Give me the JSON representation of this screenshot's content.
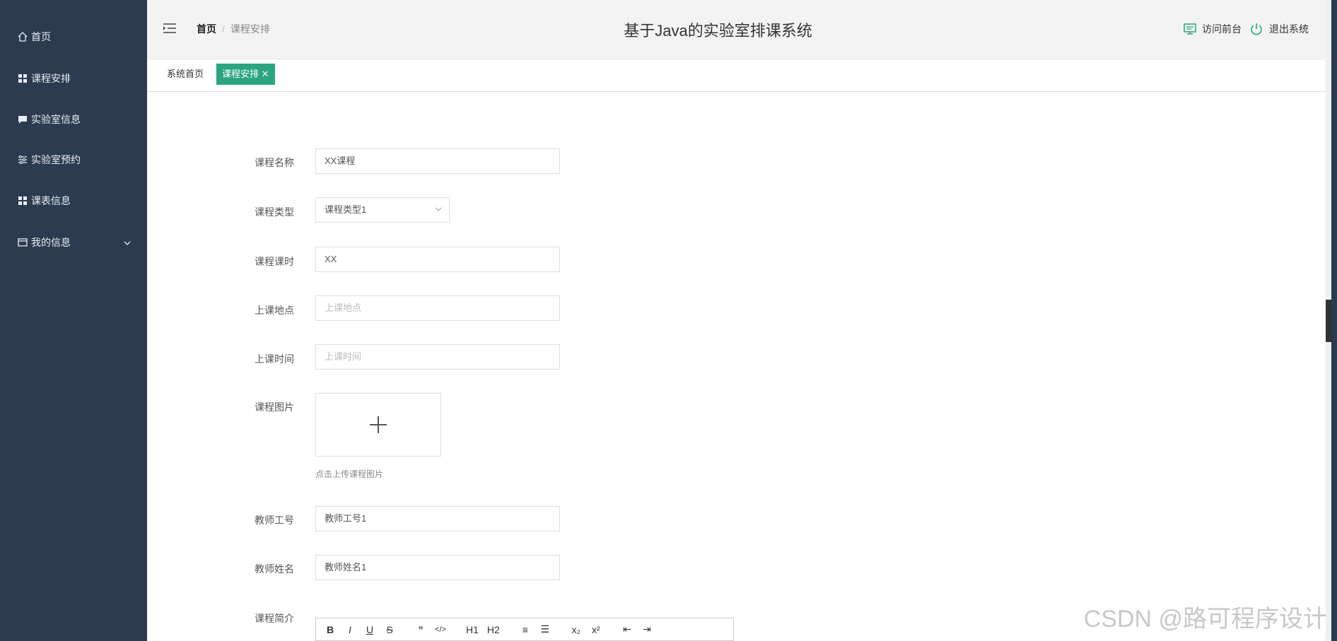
{
  "sidebar": {
    "items": [
      {
        "label": "首页",
        "icon": "home-icon"
      },
      {
        "label": "课程安排",
        "icon": "grid-icon"
      },
      {
        "label": "实验室信息",
        "icon": "message-icon"
      },
      {
        "label": "实验室预约",
        "icon": "sliders-icon"
      },
      {
        "label": "课表信息",
        "icon": "grid-icon"
      },
      {
        "label": "我的信息",
        "icon": "window-icon"
      }
    ]
  },
  "header": {
    "breadcrumb_home": "首页",
    "breadcrumb_current": "课程安排",
    "title": "基于Java的实验室排课系统",
    "visit_front": "访问前台",
    "logout": "退出系统"
  },
  "tabs": {
    "home": "系统首页",
    "active": "课程安排"
  },
  "form": {
    "course_name_label": "课程名称",
    "course_name_value": "XX课程",
    "course_type_label": "课程类型",
    "course_type_value": "课程类型1",
    "course_hours_label": "课程课时",
    "course_hours_value": "XX",
    "location_label": "上课地点",
    "location_placeholder": "上课地点",
    "time_label": "上课时间",
    "time_placeholder": "上课时间",
    "image_label": "课程图片",
    "image_hint": "点击上传课程图片",
    "teacher_id_label": "教师工号",
    "teacher_id_value": "教师工号1",
    "teacher_name_label": "教师姓名",
    "teacher_name_value": "教师姓名1",
    "intro_label": "课程简介"
  },
  "editor_toolbar": [
    "B",
    "I",
    "U",
    "S",
    "”",
    "</>",
    "H1",
    "H2",
    "≡",
    "☰",
    "x₂",
    "x²",
    "⇤",
    "⇥"
  ],
  "watermark": "CSDN @路可程序设计",
  "colors": {
    "sidebar": "#2c3b50",
    "accent": "#2aa57f"
  }
}
